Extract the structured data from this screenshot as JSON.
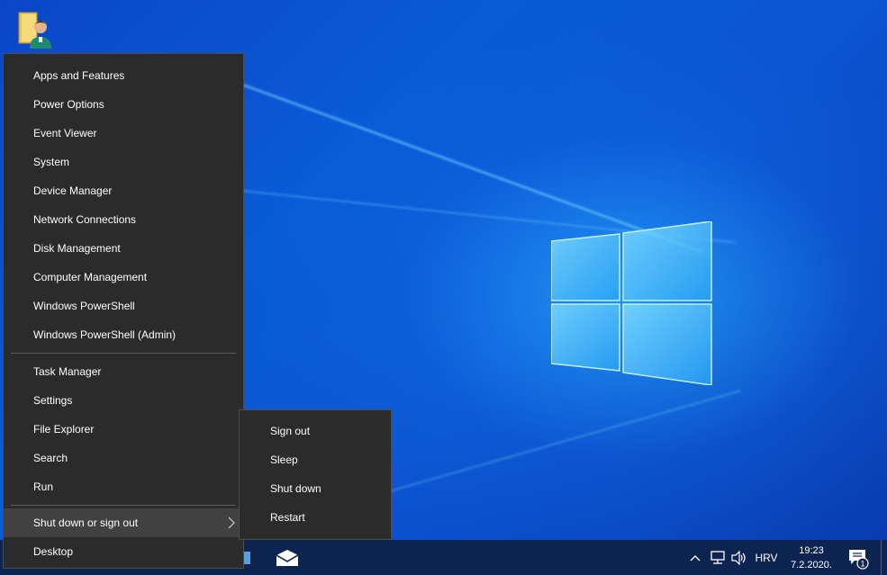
{
  "desktop": {
    "icons": [
      {
        "icon": "user-folder-icon"
      }
    ]
  },
  "winx_menu": {
    "items": [
      {
        "label": "Apps and Features",
        "id": "apps-and-features"
      },
      {
        "label": "Power Options",
        "id": "power-options"
      },
      {
        "label": "Event Viewer",
        "id": "event-viewer"
      },
      {
        "label": "System",
        "id": "system"
      },
      {
        "label": "Device Manager",
        "id": "device-manager"
      },
      {
        "label": "Network Connections",
        "id": "network-connections"
      },
      {
        "label": "Disk Management",
        "id": "disk-management"
      },
      {
        "label": "Computer Management",
        "id": "computer-management"
      },
      {
        "label": "Windows PowerShell",
        "id": "windows-powershell"
      },
      {
        "label": "Windows PowerShell (Admin)",
        "id": "windows-powershell-admin"
      },
      {
        "label": "Task Manager",
        "id": "task-manager"
      },
      {
        "label": "Settings",
        "id": "settings"
      },
      {
        "label": "File Explorer",
        "id": "file-explorer"
      },
      {
        "label": "Search",
        "id": "search"
      },
      {
        "label": "Run",
        "id": "run"
      },
      {
        "label": "Shut down or sign out",
        "id": "shut-down-or-sign-out",
        "highlighted": true,
        "has_submenu": true
      },
      {
        "label": "Desktop",
        "id": "desktop"
      }
    ]
  },
  "shutdown_submenu": {
    "items": [
      {
        "label": "Sign out",
        "id": "sign-out"
      },
      {
        "label": "Sleep",
        "id": "sleep"
      },
      {
        "label": "Shut down",
        "id": "shut-down"
      },
      {
        "label": "Restart",
        "id": "restart"
      }
    ]
  },
  "taskbar": {
    "pinned": [
      {
        "icon": "mail-icon"
      }
    ],
    "tray": {
      "chevron_icon": "chevron-up-icon",
      "network_icon": "network-icon",
      "volume_icon": "speaker-icon",
      "language": "HRV",
      "time": "19:23",
      "date": "7.2.2020.",
      "notification_count": "1"
    }
  },
  "colors": {
    "menu_bg": "#2b2b2b",
    "menu_hover": "#414141",
    "taskbar_bg": "#0d2450",
    "desktop_blue": "#0a5bd8"
  }
}
